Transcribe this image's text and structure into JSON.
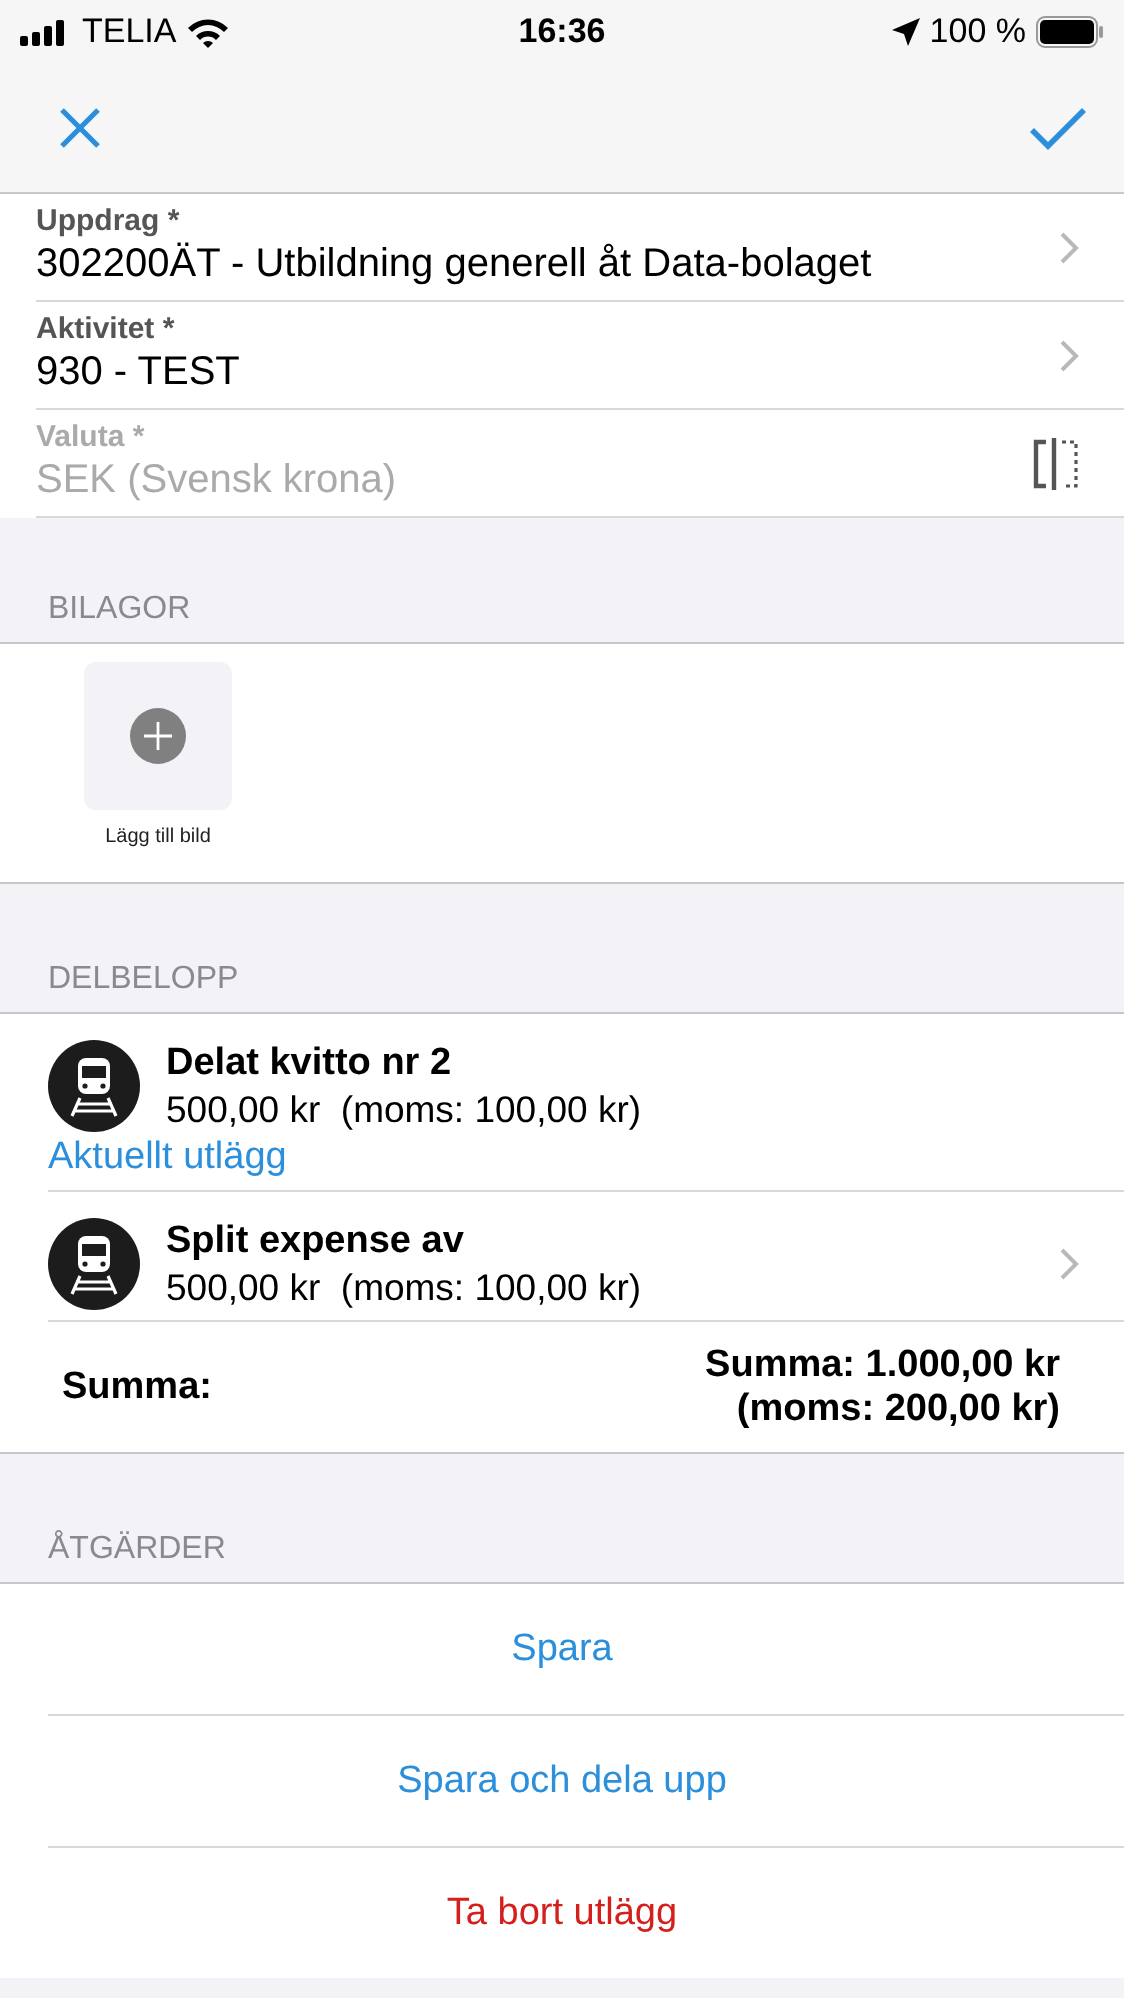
{
  "status_bar": {
    "carrier": "TELIA",
    "time": "16:36",
    "battery": "100 %"
  },
  "fields": [
    {
      "label": "Uppdrag *",
      "value": "302200ÄT - Utbildning generell åt Data-bolaget",
      "kind": "chevron",
      "disabled": false
    },
    {
      "label": "Aktivitet *",
      "value": "930 - TEST",
      "kind": "chevron",
      "disabled": false
    },
    {
      "label": "Valuta *",
      "value": "SEK (Svensk krona)",
      "kind": "split",
      "disabled": true
    }
  ],
  "attachments": {
    "header": "BILAGOR",
    "add_label": "Lägg till bild"
  },
  "split_amounts": {
    "header": "DELBELOPP",
    "items": [
      {
        "title": "Delat kvitto nr 2",
        "amount": "500,00 kr  (moms: 100,00 kr)",
        "note": "Aktuellt utlägg",
        "chevron": false
      },
      {
        "title": "Split expense av",
        "amount": "500,00 kr  (moms: 100,00 kr)",
        "chevron": true
      }
    ],
    "total_label": "Summa:",
    "total_amount": "Summa: 1.000,00 kr",
    "total_vat": "(moms: 200,00 kr)"
  },
  "actions": {
    "header": "ÅTGÄRDER",
    "items": [
      {
        "label": "Spara",
        "kind": "normal"
      },
      {
        "label": "Spara och dela upp",
        "kind": "normal"
      },
      {
        "label": "Ta bort utlägg",
        "kind": "destructive"
      }
    ]
  }
}
